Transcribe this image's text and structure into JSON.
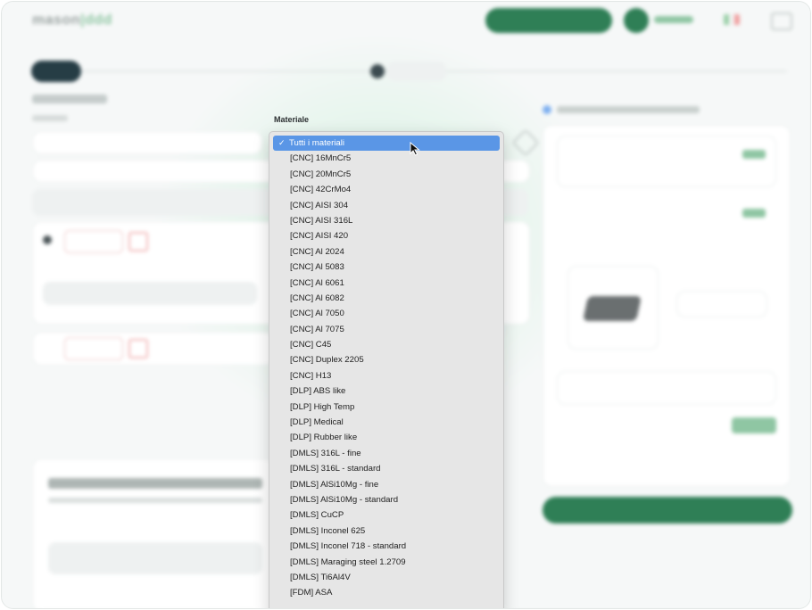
{
  "material_dropdown": {
    "label": "Materiale",
    "check_mark": "✓",
    "options": [
      {
        "label": "Tutti i materiali",
        "selected": true
      },
      {
        "label": "[CNC] 16MnCr5"
      },
      {
        "label": "[CNC] 20MnCr5"
      },
      {
        "label": "[CNC] 42CrMo4"
      },
      {
        "label": "[CNC] AISI 304"
      },
      {
        "label": "[CNC] AISI 316L"
      },
      {
        "label": "[CNC] AISI 420"
      },
      {
        "label": "[CNC] Al 2024"
      },
      {
        "label": "[CNC] Al 5083"
      },
      {
        "label": "[CNC] Al 6061"
      },
      {
        "label": "[CNC] Al 6082"
      },
      {
        "label": "[CNC] Al 7050"
      },
      {
        "label": "[CNC] Al 7075"
      },
      {
        "label": "[CNC] C45"
      },
      {
        "label": "[CNC] Duplex 2205"
      },
      {
        "label": "[CNC] H13"
      },
      {
        "label": "[DLP] ABS like"
      },
      {
        "label": "[DLP] High Temp"
      },
      {
        "label": "[DLP] Medical"
      },
      {
        "label": "[DLP] Rubber like"
      },
      {
        "label": "[DMLS] 316L - fine"
      },
      {
        "label": "[DMLS] 316L - standard"
      },
      {
        "label": "[DMLS] AlSi10Mg - fine"
      },
      {
        "label": "[DMLS] AlSi10Mg - standard"
      },
      {
        "label": "[DMLS] CuCP"
      },
      {
        "label": "[DMLS] Inconel 625"
      },
      {
        "label": "[DMLS] Inconel 718 - standard"
      },
      {
        "label": "[DMLS] Maraging steel 1.2709"
      },
      {
        "label": "[DMLS] Ti6Al4V"
      },
      {
        "label": "[FDM] ASA"
      }
    ]
  },
  "colors": {
    "selected_highlight": "#5a96e6",
    "brand_green": "#2f7f56",
    "dropdown_bg": "#e6e6e6"
  },
  "icons": {
    "cursor": "mouse-pointer-icon",
    "check": "checkmark-icon"
  }
}
